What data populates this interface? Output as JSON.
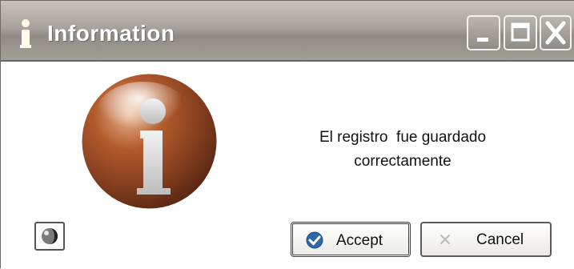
{
  "window": {
    "title": "Information",
    "title_icon": "info-i-icon",
    "buttons": [
      "minimize",
      "maximize",
      "close"
    ]
  },
  "message": {
    "line1": "El registro  fue guardado",
    "line2": "correctamente"
  },
  "icons": {
    "large": "info-orb-icon",
    "corner_button": "globe-icon",
    "accept": "check-icon",
    "cancel": "cancel-icon"
  },
  "buttons": {
    "accept_label": "Accept",
    "cancel_label": "Cancel"
  },
  "colors": {
    "titlebar": "#a6a29c",
    "info_orb": "#7f3b1d",
    "accept_icon": "#2e6aa8"
  }
}
